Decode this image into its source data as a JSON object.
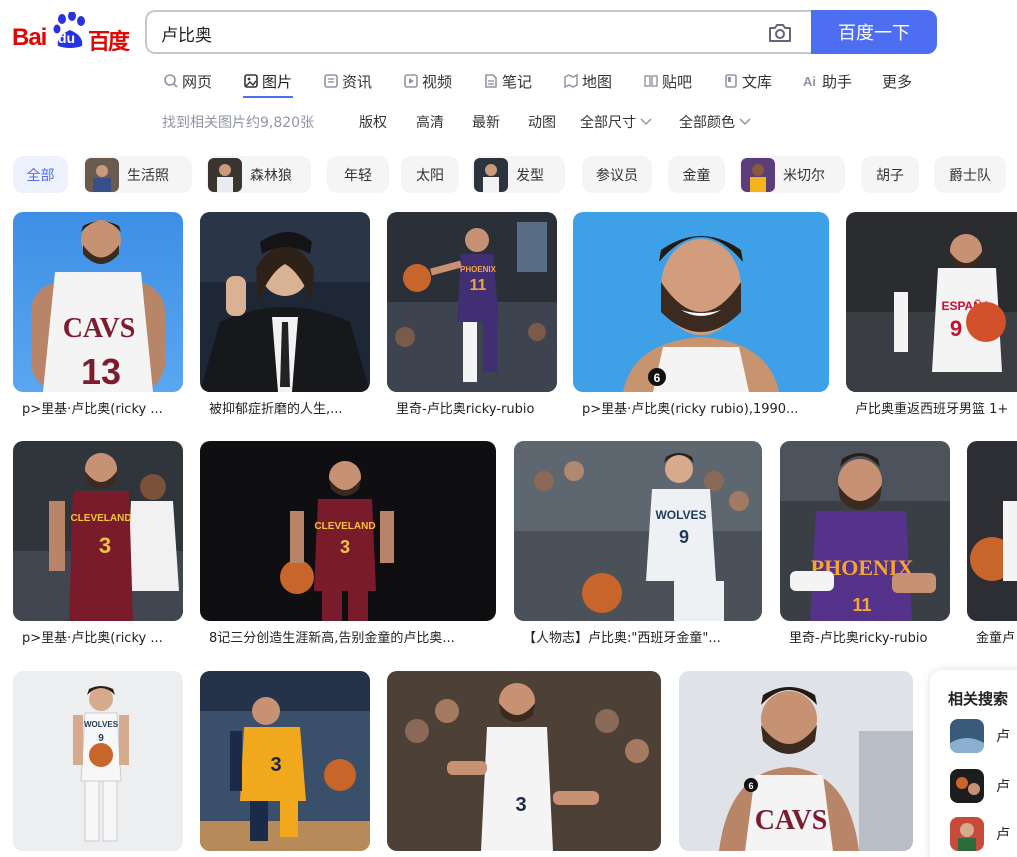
{
  "logo": {
    "part1": "Bai",
    "part2": "du",
    "part3": "百度"
  },
  "search": {
    "query": "卢比奥",
    "button_label": "百度一下"
  },
  "nav": {
    "items": [
      {
        "label": "网页",
        "icon": "search-icon"
      },
      {
        "label": "图片",
        "icon": "image-icon"
      },
      {
        "label": "资讯",
        "icon": "news-icon"
      },
      {
        "label": "视频",
        "icon": "video-icon"
      },
      {
        "label": "笔记",
        "icon": "note-icon"
      },
      {
        "label": "地图",
        "icon": "map-icon"
      },
      {
        "label": "贴吧",
        "icon": "tieba-icon"
      },
      {
        "label": "文库",
        "icon": "library-icon"
      },
      {
        "label": "助手",
        "icon": "ai-icon"
      },
      {
        "label": "更多",
        "icon": ""
      }
    ],
    "active": "图片"
  },
  "filters": {
    "count_text": "找到相关图片约9,820张",
    "items": [
      "版权",
      "高清",
      "最新",
      "动图",
      "全部尺寸",
      "全部颜色"
    ]
  },
  "chips": [
    {
      "label": "全部"
    },
    {
      "label": "生活照"
    },
    {
      "label": "森林狼"
    },
    {
      "label": "年轻"
    },
    {
      "label": "太阳"
    },
    {
      "label": "发型"
    },
    {
      "label": "参议员"
    },
    {
      "label": "金童"
    },
    {
      "label": "米切尔"
    },
    {
      "label": "胡子"
    },
    {
      "label": "爵士队"
    }
  ],
  "images": {
    "row1": [
      {
        "caption": "p>里基·卢比奥(ricky ...",
        "jersey": "CAVS",
        "number": "13"
      },
      {
        "caption": "被抑郁症折磨的人生,..."
      },
      {
        "caption": "里奇-卢比奥ricky-rubio",
        "jersey": "PHOENIX",
        "number": "11"
      },
      {
        "caption": "p>里基·卢比奥(ricky rubio),1990...",
        "number": "6"
      },
      {
        "caption": "卢比奥重返西班牙男篮 1+",
        "jersey": "ESPAÑA",
        "number": "9"
      }
    ],
    "row2": [
      {
        "caption": "p>里基·卢比奥(ricky ...",
        "jersey": "CLEVELAND",
        "number": "3"
      },
      {
        "caption": "8记三分创造生涯新高,告别金童的卢比奥...",
        "jersey": "CLEVELAND",
        "number": "3"
      },
      {
        "caption": "【人物志】卢比奥:\"西班牙金童\"...",
        "jersey": "WOLVES",
        "number": "9"
      },
      {
        "caption": "里奇-卢比奥ricky-rubio",
        "jersey": "PHOENIX",
        "number": "11"
      },
      {
        "caption": "金童卢"
      }
    ],
    "row3": [
      {
        "jersey": "WOLVES",
        "number": "9"
      },
      {
        "number": "3"
      },
      {
        "number": "3"
      },
      {
        "jersey": "CAVS",
        "number": "6"
      }
    ]
  },
  "related": {
    "title": "相关搜索",
    "items": [
      {
        "label": "卢"
      },
      {
        "label": "卢"
      },
      {
        "label": "卢"
      }
    ]
  },
  "colors": {
    "brand_red": "#e10601",
    "brand_blue": "#4e6ef2"
  }
}
